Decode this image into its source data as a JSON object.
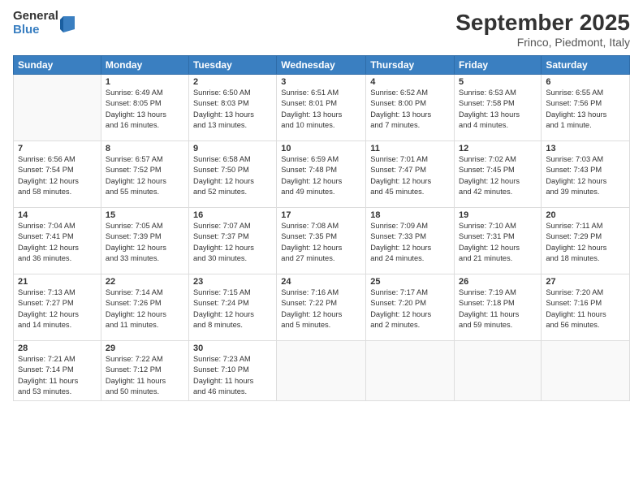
{
  "header": {
    "logo_general": "General",
    "logo_blue": "Blue",
    "month_title": "September 2025",
    "location": "Frinco, Piedmont, Italy"
  },
  "days_of_week": [
    "Sunday",
    "Monday",
    "Tuesday",
    "Wednesday",
    "Thursday",
    "Friday",
    "Saturday"
  ],
  "weeks": [
    [
      {
        "day": "",
        "info": ""
      },
      {
        "day": "1",
        "info": "Sunrise: 6:49 AM\nSunset: 8:05 PM\nDaylight: 13 hours\nand 16 minutes."
      },
      {
        "day": "2",
        "info": "Sunrise: 6:50 AM\nSunset: 8:03 PM\nDaylight: 13 hours\nand 13 minutes."
      },
      {
        "day": "3",
        "info": "Sunrise: 6:51 AM\nSunset: 8:01 PM\nDaylight: 13 hours\nand 10 minutes."
      },
      {
        "day": "4",
        "info": "Sunrise: 6:52 AM\nSunset: 8:00 PM\nDaylight: 13 hours\nand 7 minutes."
      },
      {
        "day": "5",
        "info": "Sunrise: 6:53 AM\nSunset: 7:58 PM\nDaylight: 13 hours\nand 4 minutes."
      },
      {
        "day": "6",
        "info": "Sunrise: 6:55 AM\nSunset: 7:56 PM\nDaylight: 13 hours\nand 1 minute."
      }
    ],
    [
      {
        "day": "7",
        "info": "Sunrise: 6:56 AM\nSunset: 7:54 PM\nDaylight: 12 hours\nand 58 minutes."
      },
      {
        "day": "8",
        "info": "Sunrise: 6:57 AM\nSunset: 7:52 PM\nDaylight: 12 hours\nand 55 minutes."
      },
      {
        "day": "9",
        "info": "Sunrise: 6:58 AM\nSunset: 7:50 PM\nDaylight: 12 hours\nand 52 minutes."
      },
      {
        "day": "10",
        "info": "Sunrise: 6:59 AM\nSunset: 7:48 PM\nDaylight: 12 hours\nand 49 minutes."
      },
      {
        "day": "11",
        "info": "Sunrise: 7:01 AM\nSunset: 7:47 PM\nDaylight: 12 hours\nand 45 minutes."
      },
      {
        "day": "12",
        "info": "Sunrise: 7:02 AM\nSunset: 7:45 PM\nDaylight: 12 hours\nand 42 minutes."
      },
      {
        "day": "13",
        "info": "Sunrise: 7:03 AM\nSunset: 7:43 PM\nDaylight: 12 hours\nand 39 minutes."
      }
    ],
    [
      {
        "day": "14",
        "info": "Sunrise: 7:04 AM\nSunset: 7:41 PM\nDaylight: 12 hours\nand 36 minutes."
      },
      {
        "day": "15",
        "info": "Sunrise: 7:05 AM\nSunset: 7:39 PM\nDaylight: 12 hours\nand 33 minutes."
      },
      {
        "day": "16",
        "info": "Sunrise: 7:07 AM\nSunset: 7:37 PM\nDaylight: 12 hours\nand 30 minutes."
      },
      {
        "day": "17",
        "info": "Sunrise: 7:08 AM\nSunset: 7:35 PM\nDaylight: 12 hours\nand 27 minutes."
      },
      {
        "day": "18",
        "info": "Sunrise: 7:09 AM\nSunset: 7:33 PM\nDaylight: 12 hours\nand 24 minutes."
      },
      {
        "day": "19",
        "info": "Sunrise: 7:10 AM\nSunset: 7:31 PM\nDaylight: 12 hours\nand 21 minutes."
      },
      {
        "day": "20",
        "info": "Sunrise: 7:11 AM\nSunset: 7:29 PM\nDaylight: 12 hours\nand 18 minutes."
      }
    ],
    [
      {
        "day": "21",
        "info": "Sunrise: 7:13 AM\nSunset: 7:27 PM\nDaylight: 12 hours\nand 14 minutes."
      },
      {
        "day": "22",
        "info": "Sunrise: 7:14 AM\nSunset: 7:26 PM\nDaylight: 12 hours\nand 11 minutes."
      },
      {
        "day": "23",
        "info": "Sunrise: 7:15 AM\nSunset: 7:24 PM\nDaylight: 12 hours\nand 8 minutes."
      },
      {
        "day": "24",
        "info": "Sunrise: 7:16 AM\nSunset: 7:22 PM\nDaylight: 12 hours\nand 5 minutes."
      },
      {
        "day": "25",
        "info": "Sunrise: 7:17 AM\nSunset: 7:20 PM\nDaylight: 12 hours\nand 2 minutes."
      },
      {
        "day": "26",
        "info": "Sunrise: 7:19 AM\nSunset: 7:18 PM\nDaylight: 11 hours\nand 59 minutes."
      },
      {
        "day": "27",
        "info": "Sunrise: 7:20 AM\nSunset: 7:16 PM\nDaylight: 11 hours\nand 56 minutes."
      }
    ],
    [
      {
        "day": "28",
        "info": "Sunrise: 7:21 AM\nSunset: 7:14 PM\nDaylight: 11 hours\nand 53 minutes."
      },
      {
        "day": "29",
        "info": "Sunrise: 7:22 AM\nSunset: 7:12 PM\nDaylight: 11 hours\nand 50 minutes."
      },
      {
        "day": "30",
        "info": "Sunrise: 7:23 AM\nSunset: 7:10 PM\nDaylight: 11 hours\nand 46 minutes."
      },
      {
        "day": "",
        "info": ""
      },
      {
        "day": "",
        "info": ""
      },
      {
        "day": "",
        "info": ""
      },
      {
        "day": "",
        "info": ""
      }
    ]
  ]
}
